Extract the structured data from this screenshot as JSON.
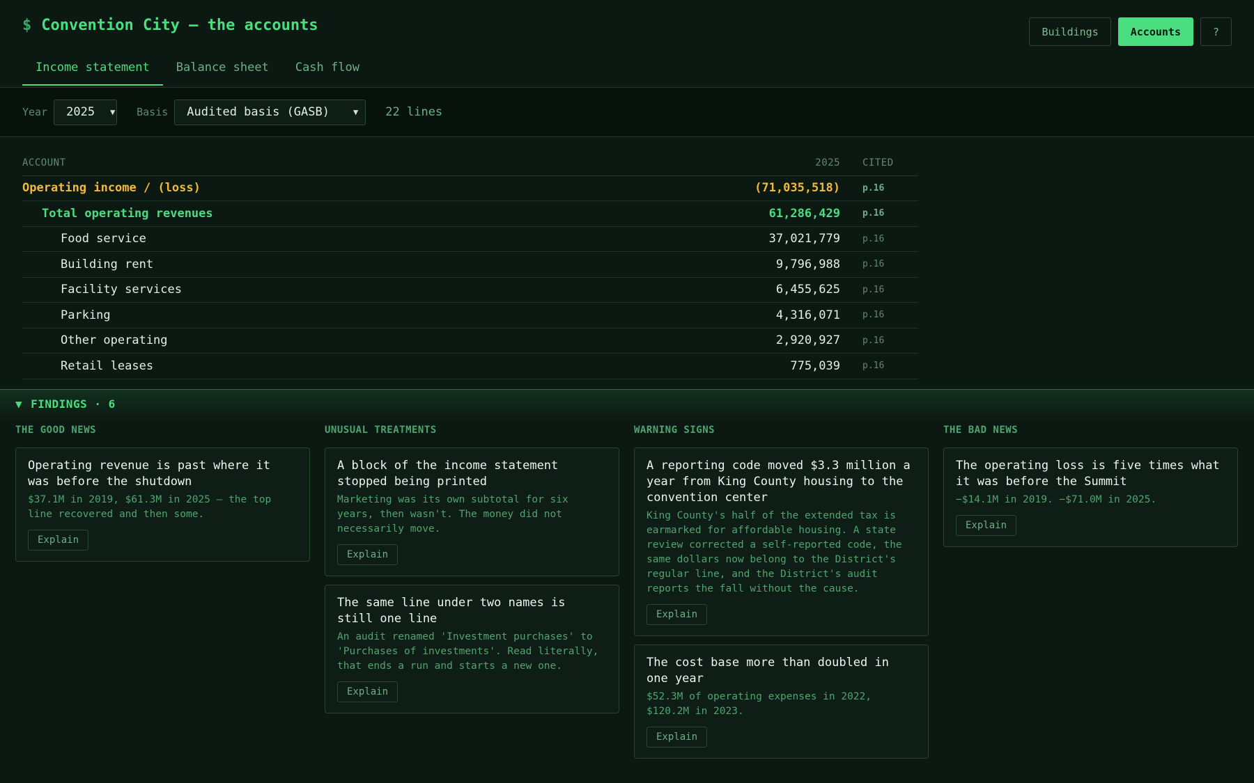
{
  "header": {
    "icon": "$",
    "title": "Convention City — the accounts",
    "buttons": [
      "Buildings",
      "Accounts",
      "?"
    ]
  },
  "tabs": [
    "Income statement",
    "Balance sheet",
    "Cash flow"
  ],
  "filters": {
    "year_label": "Year",
    "year_value": "2025",
    "basis_label": "Basis",
    "basis_value": "Audited basis (GASB)",
    "line_count": "22 lines"
  },
  "table": {
    "headers": [
      "ACCOUNT",
      "2025",
      "CITED"
    ],
    "rows": [
      {
        "account": "Operating income / (loss)",
        "value": "(71,035,518)",
        "cited": "p.16"
      },
      {
        "account": "Total operating revenues",
        "value": "61,286,429",
        "cited": "p.16"
      },
      {
        "account": "Food service",
        "value": "37,021,779",
        "cited": "p.16"
      },
      {
        "account": "Building rent",
        "value": "9,796,988",
        "cited": "p.16"
      },
      {
        "account": "Facility services",
        "value": "6,455,625",
        "cited": "p.16"
      },
      {
        "account": "Parking",
        "value": "4,316,071",
        "cited": "p.16"
      },
      {
        "account": "Other operating",
        "value": "2,920,927",
        "cited": "p.16"
      },
      {
        "account": "Retail leases",
        "value": "775,039",
        "cited": "p.16"
      }
    ]
  },
  "findings": {
    "title": "FINDINGS · 6",
    "toggle_icon": "▼",
    "explain_label": "Explain",
    "columns": [
      {
        "title": "THE GOOD NEWS",
        "cards": [
          {
            "title": "Operating revenue is past where it was before the shutdown",
            "body": "$37.1M in 2019, $61.3M in 2025 — the top line recovered and then some."
          }
        ]
      },
      {
        "title": "UNUSUAL TREATMENTS",
        "cards": [
          {
            "title": "A block of the income statement stopped being printed",
            "body": "Marketing was its own subtotal for six years, then wasn't. The money did not necessarily move."
          },
          {
            "title": "The same line under two names is still one line",
            "body": "An audit renamed 'Investment purchases' to 'Purchases of investments'. Read literally, that ends a run and starts a new one."
          }
        ]
      },
      {
        "title": "WARNING SIGNS",
        "cards": [
          {
            "title": "A reporting code moved $3.3 million a year from King County housing to the convention center",
            "body": "King County's half of the extended tax is earmarked for affordable housing. A state review corrected a self-reported code, the same dollars now belong to the District's regular line, and the District's audit reports the fall without the cause."
          },
          {
            "title": "The cost base more than doubled in one year",
            "body": "$52.3M of operating expenses in 2022, $120.2M in 2023."
          }
        ]
      },
      {
        "title": "THE BAD NEWS",
        "cards": [
          {
            "title": "The operating loss is five times what it was before the Summit",
            "body": "−$14.1M in 2019. −$71.0M in 2025."
          }
        ]
      }
    ]
  }
}
